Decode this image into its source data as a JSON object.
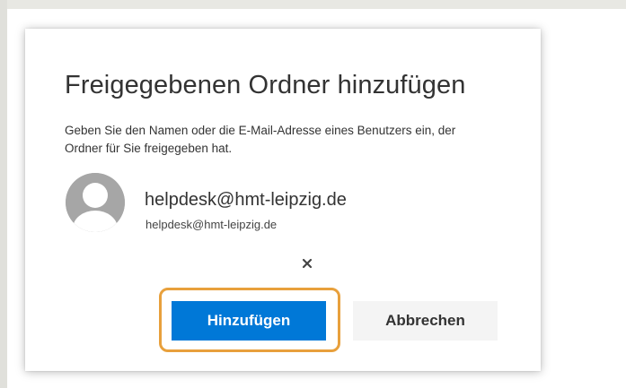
{
  "dialog": {
    "title": "Freigegebenen Ordner hinzufügen",
    "description": "Geben Sie den Namen oder die E-Mail-Adresse eines Benutzers ein, der Ordner für Sie freigegeben hat.",
    "user": {
      "display_name": "helpdesk@hmt-leipzig.de",
      "email": "helpdesk@hmt-leipzig.de",
      "avatar_icon": "person-placeholder-icon"
    },
    "remove_icon": "close-icon",
    "remove_glyph": "×",
    "add_button_label": "Hinzufügen",
    "cancel_button_label": "Abbrechen"
  },
  "colors": {
    "primary_button": "#0078d7",
    "highlight_outline": "#e8a03c",
    "secondary_button": "#f4f4f4",
    "text": "#333333"
  }
}
